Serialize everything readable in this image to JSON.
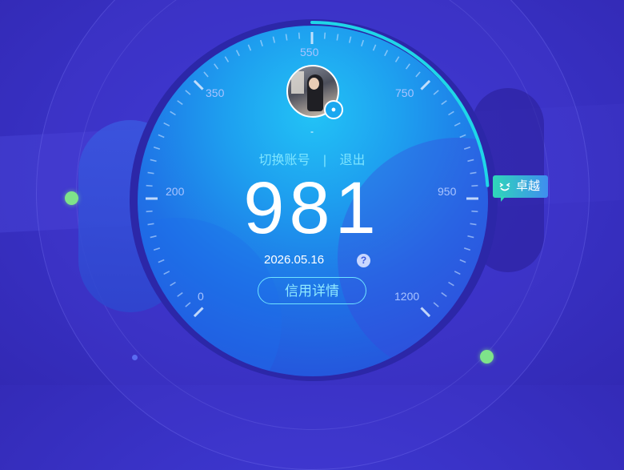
{
  "user": {
    "nickname": "-",
    "switch_account": "切换账号",
    "separator": "|",
    "logout": "退出",
    "badge_icon": "qq-penguin-icon"
  },
  "score": {
    "value": "981",
    "date": "2026.05.16",
    "help_icon": "question-icon",
    "help_glyph": "?",
    "detail_button": "信用详情",
    "level": "卓越",
    "level_icon": "smiley-icon"
  },
  "gauge": {
    "min": 0,
    "max": 1200,
    "current": 981,
    "labels": [
      "0",
      "200",
      "350",
      "550",
      "750",
      "950",
      "1200"
    ]
  },
  "colors": {
    "background": "#3a33c8",
    "accent": "#1fd6e8",
    "link": "#7ee5ff",
    "green_dot": "#7ee38a",
    "badge_start": "#2fd7b9",
    "badge_end": "#3f8df0"
  }
}
